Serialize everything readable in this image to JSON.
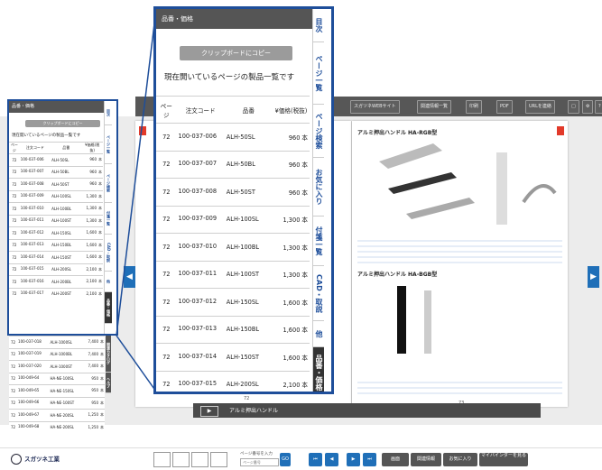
{
  "toolbar": {
    "buttons": [
      "スガツネWEBサイト",
      "関連情報一覧",
      "印刷",
      "PDF",
      "URLを連絡"
    ]
  },
  "pages": {
    "left_number": "72",
    "right_number": "73",
    "right_title_top": "アルミ押出ハンドル HA-RGB型",
    "right_title_bottom": "アルミ押出ハンドル HA-BGB型",
    "bottom_caption": "アルミ押出ハンドル"
  },
  "panel": {
    "header": "品番・価格",
    "copy_button": "クリップボードにコピー",
    "description": "現在開いているページの製品一覧です",
    "columns": [
      "ページ",
      "注文コード",
      "品番",
      "¥価格(税抜)"
    ],
    "rows": [
      [
        "72",
        "100-037-006",
        "ALH-50SL",
        "960"
      ],
      [
        "72",
        "100-037-007",
        "ALH-50BL",
        "960"
      ],
      [
        "72",
        "100-037-008",
        "ALH-50ST",
        "960"
      ],
      [
        "72",
        "100-037-009",
        "ALH-100SL",
        "1,300"
      ],
      [
        "72",
        "100-037-010",
        "ALH-100BL",
        "1,300"
      ],
      [
        "72",
        "100-037-011",
        "ALH-100ST",
        "1,300"
      ],
      [
        "72",
        "100-037-012",
        "ALH-150SL",
        "1,600"
      ],
      [
        "72",
        "100-037-013",
        "ALH-150BL",
        "1,600"
      ],
      [
        "72",
        "100-037-014",
        "ALH-150ST",
        "1,600"
      ],
      [
        "72",
        "100-037-015",
        "ALH-200SL",
        "2,100"
      ],
      [
        "72",
        "100-037-016",
        "ALH-200BL",
        "2,100"
      ],
      [
        "72",
        "100-037-017",
        "ALH-200ST",
        "2,100"
      ]
    ],
    "unit": "本"
  },
  "small_panel_extra_rows": [
    [
      "72",
      "100-037-018",
      "ALH-1000SL",
      "7,400"
    ],
    [
      "72",
      "100-037-019",
      "ALH-1000BL",
      "7,400"
    ],
    [
      "72",
      "100-037-020",
      "ALH-1000ST",
      "7,400"
    ],
    [
      "72",
      "100-049-64",
      "HA-NE-100SL",
      "950"
    ],
    [
      "72",
      "100-049-65",
      "HA-NE-150SL",
      "950"
    ],
    [
      "72",
      "100-049-66",
      "HA-NE-100ST",
      "950"
    ],
    [
      "72",
      "100-049-67",
      "HA-NE-200SL",
      "1,250"
    ],
    [
      "72",
      "100-049-68",
      "HA-NE-200SL",
      "1,250"
    ]
  ],
  "tabs": [
    "目次",
    "ページ一覧",
    "ページ検索",
    "お気に入り",
    "付箋一覧",
    "CAD・取説",
    "他",
    "品番・価格",
    "関"
  ],
  "small_tabs": [
    "目次",
    "ページ一覧",
    "ページ検索",
    "付箋一覧",
    "CAD・取説",
    "他",
    "品番・価格",
    "関連カタログ",
    "ヘルプ"
  ],
  "footer": {
    "logo": "スガツネ工業",
    "page_input_label": "ページ番号を入力",
    "page_input_placeholder": "ページ番号",
    "go": "GO",
    "actions": [
      "画面",
      "関連情報",
      "お気に入り",
      "マイバインダーを見る"
    ]
  },
  "colors": {
    "accent": "#1e4e9a",
    "nav": "#1f6fb8",
    "toolbar": "#575757"
  }
}
